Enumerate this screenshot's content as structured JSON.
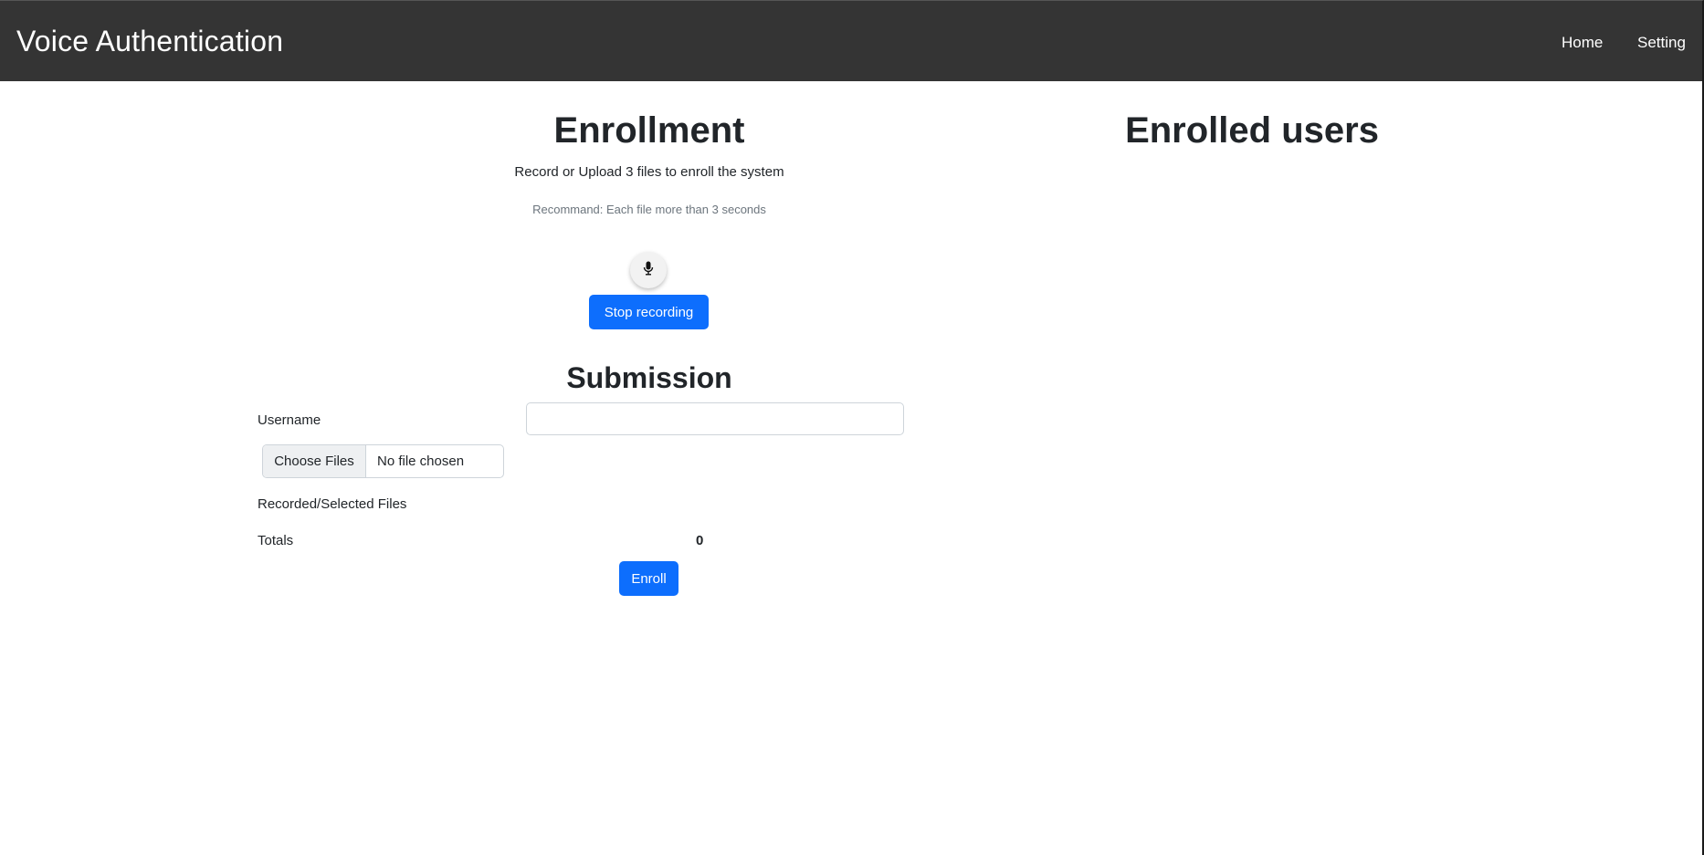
{
  "navbar": {
    "brand": "Voice Authentication",
    "links": [
      {
        "label": "Home"
      },
      {
        "label": "Setting"
      }
    ]
  },
  "enrollment": {
    "title": "Enrollment",
    "instruction": "Record or Upload 3 files to enroll the system",
    "recommendation": "Recommand: Each file more than 3 seconds",
    "mic_icon": "microphone-icon",
    "stop_label": "Stop recording"
  },
  "submission": {
    "title": "Submission",
    "username_label": "Username",
    "username_value": "",
    "file_button_label": "Choose Files",
    "file_status": "No file chosen",
    "files_label": "Recorded/Selected Files",
    "totals_label": "Totals",
    "totals_value": "0",
    "enroll_label": "Enroll"
  },
  "enrolled_users": {
    "title": "Enrolled users"
  },
  "colors": {
    "navbar_bg": "#343434",
    "primary": "#0d6efd"
  }
}
